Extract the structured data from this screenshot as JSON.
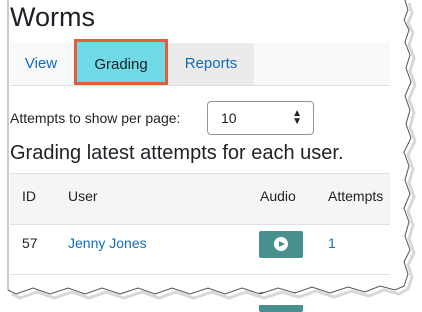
{
  "page": {
    "title": "Worms"
  },
  "tabs": [
    {
      "label": "View"
    },
    {
      "label": "Grading",
      "active": true
    },
    {
      "label": "Reports"
    }
  ],
  "per_page": {
    "label": "Attempts to show per page:",
    "selected": "10"
  },
  "heading": "Grading latest attempts for each user.",
  "table": {
    "columns": [
      "ID",
      "User",
      "Audio",
      "Attempts"
    ],
    "rows": [
      {
        "id": "57",
        "user": "Jenny Jones",
        "audio": "play-icon",
        "attempts": "1"
      }
    ]
  },
  "colors": {
    "accent_link": "#0f6cbf",
    "highlight_fill": "#6fd9e6",
    "highlight_border": "#e25c44",
    "play_button": "#4a8f8f"
  }
}
